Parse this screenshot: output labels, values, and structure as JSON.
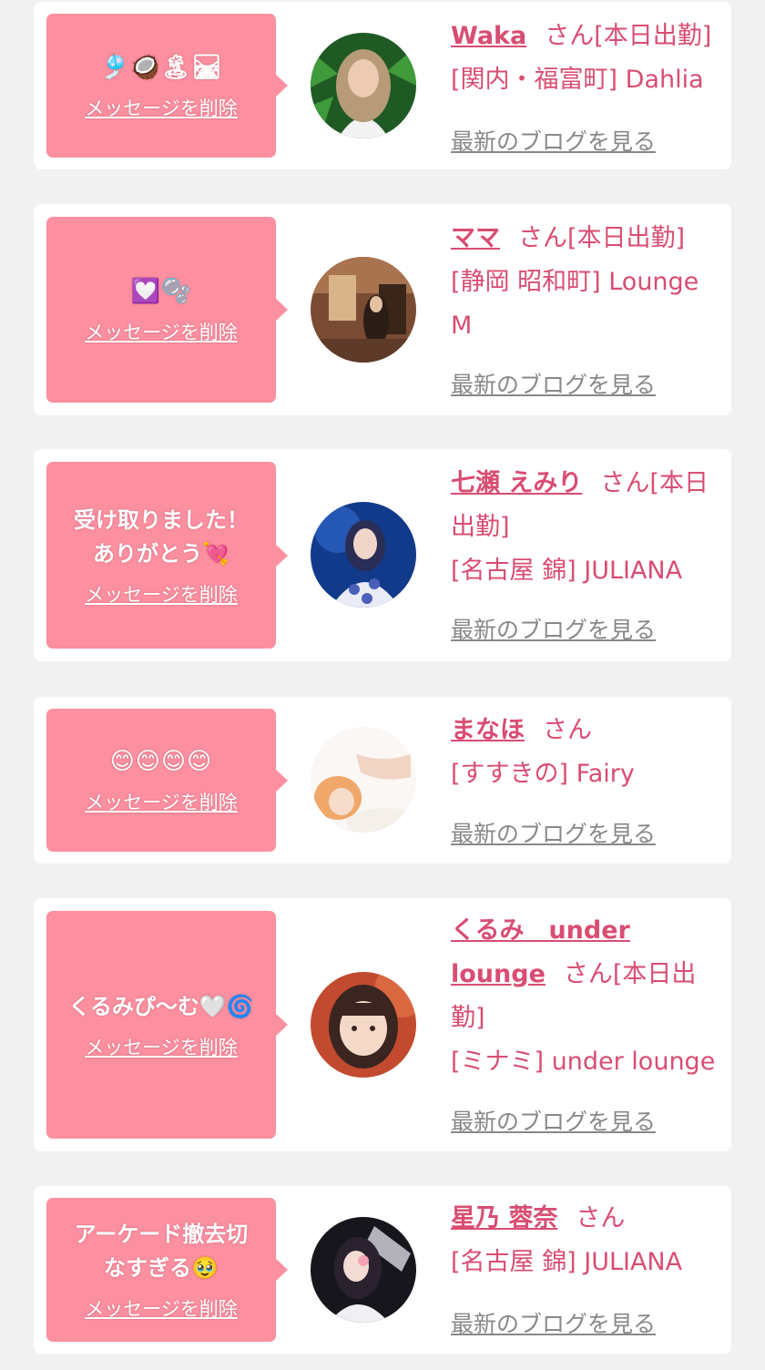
{
  "cards": [
    {
      "message": "🎐🥥🏝🛤",
      "delete_label": "メッセージを削除",
      "name": "Waka",
      "suffix": "さん[本日出勤]",
      "shop": "[関内・福富町] Dahlia",
      "blog_label": "最新のブログを見る"
    },
    {
      "message": "💟🫧",
      "delete_label": "メッセージを削除",
      "name": "ママ",
      "suffix": "さん[本日出勤]",
      "shop": "[静岡 昭和町] Lounge M",
      "blog_label": "最新のブログを見る"
    },
    {
      "message": "受け取りました！\nありがとう💘",
      "delete_label": "メッセージを削除",
      "name": "七瀬 えみり",
      "suffix": "さん[本日出勤]",
      "shop": "[名古屋 錦] JULIANA",
      "blog_label": "最新のブログを見る"
    },
    {
      "message": "😊😊😊😊",
      "delete_label": "メッセージを削除",
      "name": "まなほ",
      "suffix": "さん",
      "shop": "[すすきの] Fairy",
      "blog_label": "最新のブログを見る"
    },
    {
      "message": "くるみぴ〜む🤍🌀",
      "delete_label": "メッセージを削除",
      "name": "くるみ　under lounge",
      "suffix": "さん[本日出勤]",
      "shop": "[ミナミ] under lounge",
      "blog_label": "最新のブログを見る"
    },
    {
      "message": "アーケード撤去切\nなすぎる🥹",
      "delete_label": "メッセージを削除",
      "name": "星乃 蓉奈",
      "suffix": "さん",
      "shop": "[名古屋 錦] JULIANA",
      "blog_label": "最新のブログを見る"
    }
  ]
}
